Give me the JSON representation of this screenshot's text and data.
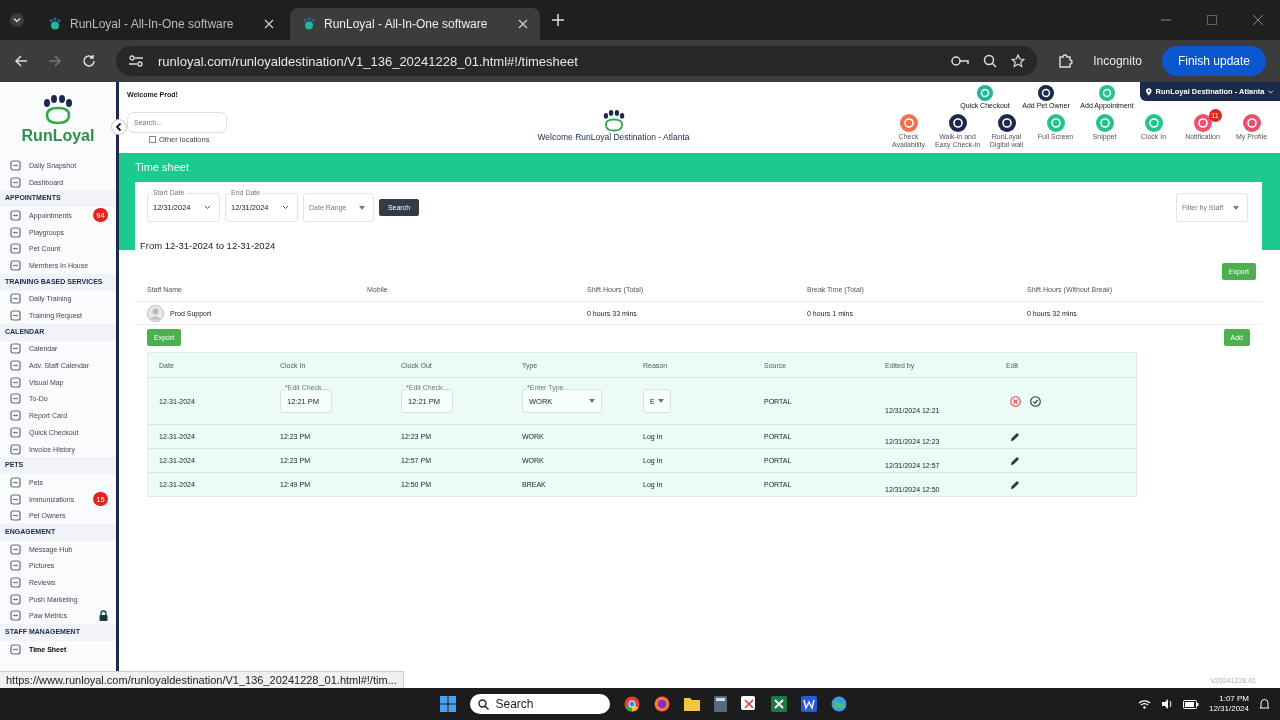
{
  "browser": {
    "tabs": [
      {
        "title": "RunLoyal - All-In-One software",
        "selected": false
      },
      {
        "title": "RunLoyal - All-In-One software",
        "selected": true
      }
    ],
    "url": "runloyal.com/runloyaldestination/V1_136_20241228_01.html#!/timesheet",
    "incognito": "Incognito",
    "update_button": "Finish update"
  },
  "sidebar": {
    "logo": "RunLoyal",
    "sections": [
      {
        "items": [
          {
            "label": "Daily Snapshot",
            "selected": false,
            "locked": false
          },
          {
            "label": "Dashboard",
            "selected": false,
            "locked": false
          }
        ]
      },
      {
        "title": "APPOINTMENTS",
        "items": [
          {
            "label": "Appointments",
            "badge": "94",
            "selected": false,
            "locked": false
          },
          {
            "label": "Playgroups",
            "selected": false,
            "locked": false
          },
          {
            "label": "Pet Count",
            "selected": false,
            "locked": false
          },
          {
            "label": "Members In House",
            "selected": false,
            "locked": false
          }
        ]
      },
      {
        "title": "TRAINING BASED SERVICES",
        "items": [
          {
            "label": "Daily Training",
            "selected": false,
            "locked": false
          },
          {
            "label": "Training Request",
            "selected": false,
            "locked": false
          }
        ]
      },
      {
        "title": "CALENDAR",
        "items": [
          {
            "label": "Calendar",
            "selected": false,
            "locked": false
          },
          {
            "label": "Adv. Staff Calendar",
            "selected": false,
            "locked": false
          },
          {
            "label": "Visual Map",
            "selected": false,
            "locked": false
          },
          {
            "label": "To-Do",
            "selected": false,
            "locked": false
          },
          {
            "label": "Report Card",
            "selected": false,
            "locked": false
          },
          {
            "label": "Quick Checkout",
            "selected": false,
            "locked": false
          },
          {
            "label": "Invoice History",
            "selected": false,
            "locked": false
          }
        ]
      },
      {
        "title": "PETS",
        "items": [
          {
            "label": "Pets",
            "selected": false,
            "locked": false
          },
          {
            "label": "Immunizations",
            "badge": "15",
            "selected": false,
            "locked": false
          },
          {
            "label": "Pet Owners",
            "selected": false,
            "locked": false
          }
        ]
      },
      {
        "title": "ENGAGEMENT",
        "items": [
          {
            "label": "Message Hub",
            "selected": false,
            "locked": false
          },
          {
            "label": "Pictures",
            "selected": false,
            "locked": false
          },
          {
            "label": "Reviews",
            "selected": false,
            "locked": false
          },
          {
            "label": "Push Marketing",
            "selected": false,
            "locked": false
          },
          {
            "label": "Paw Metrics",
            "selected": false,
            "locked": true
          }
        ]
      },
      {
        "title": "STAFF MANAGEMENT",
        "items": [
          {
            "label": "Time Sheet",
            "selected": true,
            "locked": false
          }
        ]
      }
    ]
  },
  "header": {
    "welcome": "Welcome Prod!",
    "search": {
      "placeholder": "Search..."
    },
    "other_locations": {
      "label": "Other locations",
      "checked": false
    },
    "center_title": "Welcome RunLoyal Destination - Atlanta",
    "location": "RunLoyal Destination - Atlanta",
    "quick_actions": [
      {
        "label": "Quick Checkout",
        "color": "#1fb89a"
      },
      {
        "label": "Add Pet Owner",
        "color": "#1b2a4a"
      },
      {
        "label": "Add Appointment",
        "color": "#22c48a"
      }
    ],
    "actions": [
      {
        "label": "Check Availability",
        "color": "#f2704e"
      },
      {
        "label": "Walk-in and Easy Check-in",
        "color": "#1b2a4a"
      },
      {
        "label": "RunLoyal Digital wall",
        "color": "#1b2a4a"
      },
      {
        "label": "Full Screen",
        "color": "#22c48a"
      },
      {
        "label": "Snippet",
        "color": "#22c48a"
      },
      {
        "label": "Clock In",
        "color": "#22c48a"
      },
      {
        "label": "Notification",
        "color": "#f0506e",
        "badge": "11"
      },
      {
        "label": "My Profile",
        "color": "#e8506e"
      }
    ]
  },
  "page_title": "Time sheet",
  "filters": {
    "start_date": {
      "label": "Start Date",
      "value": "12/31/2024"
    },
    "end_date": {
      "label": "End Date",
      "value": "12/31/2024"
    },
    "date_range": {
      "placeholder": "Date Range"
    },
    "search_button": "Search",
    "staff_filter": {
      "placeholder": "Filter by Staff"
    }
  },
  "range_text": "From 12-31-2024 to 12-31-2024",
  "export_button": "Export",
  "summary": {
    "columns": [
      "Staff Name",
      "Mobile",
      "Shift Hours (Total)",
      "Break Time (Total)",
      "Shift Hours (Without Break)"
    ],
    "rows": [
      {
        "name": "Prod Support",
        "shift": "0 hours 33 mins",
        "break": "0 hours 1 mins",
        "net": "0 hours 32 mins"
      }
    ]
  },
  "detail_export_button": "Export",
  "add_button": "Add",
  "detail": {
    "columns": [
      "Date",
      "Clock In",
      "Clock Out",
      "Type",
      "Reason",
      "Source",
      "Edited by",
      "Edit"
    ],
    "rows": [
      {
        "kind": "edit",
        "date": "12-31-2024",
        "clock_in": {
          "label": "*Edit Check...",
          "value": "12:21 PM"
        },
        "clock_out": {
          "label": "*Edit Check...",
          "value": "12:21 PM"
        },
        "type": {
          "label": "*Enter Type",
          "value": "WORK"
        },
        "reason": "E",
        "source": "PORTAL",
        "edited_by": "12/31/2024 12:21"
      },
      {
        "kind": "view",
        "date": "12-31-2024",
        "clock_in": "12:23 PM",
        "clock_out": "12:23 PM",
        "type": "WORK",
        "reason": "Log In",
        "source": "PORTAL",
        "edited_by": "12/31/2024 12:23"
      },
      {
        "kind": "view",
        "date": "12-31-2024",
        "clock_in": "12:23 PM",
        "clock_out": "12:57 PM",
        "type": "WORK",
        "reason": "Log In",
        "source": "PORTAL",
        "edited_by": "12/31/2024 12:57"
      },
      {
        "kind": "view",
        "date": "12-31-2024",
        "clock_in": "12:49 PM",
        "clock_out": "12:50 PM",
        "type": "BREAK",
        "reason": "Log In",
        "source": "PORTAL",
        "edited_by": "12/31/2024 12:50"
      }
    ]
  },
  "version": "V20241228.01",
  "status_url": "https://www.runloyal.com/runloyaldestination/V1_136_20241228_01.html#!/tim...",
  "taskbar": {
    "search": "Search",
    "time": "1:07 PM",
    "date": "12/31/2024"
  }
}
